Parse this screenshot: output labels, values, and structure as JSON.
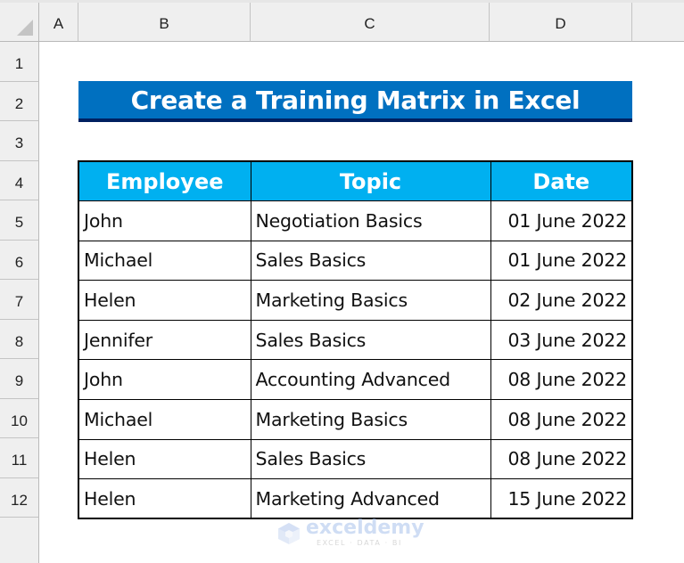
{
  "spreadsheet": {
    "column_headers": [
      "A",
      "B",
      "C",
      "D"
    ],
    "row_headers": [
      "1",
      "2",
      "3",
      "4",
      "5",
      "6",
      "7",
      "8",
      "9",
      "10",
      "11",
      "12"
    ]
  },
  "title": "Create a Training Matrix in Excel",
  "table": {
    "headers": [
      "Employee",
      "Topic",
      "Date"
    ],
    "rows": [
      {
        "employee": "John",
        "topic": "Negotiation Basics",
        "date": "01 June 2022"
      },
      {
        "employee": "Michael",
        "topic": "Sales Basics",
        "date": "01 June 2022"
      },
      {
        "employee": "Helen",
        "topic": "Marketing Basics",
        "date": "02 June 2022"
      },
      {
        "employee": "Jennifer",
        "topic": "Sales Basics",
        "date": "03 June 2022"
      },
      {
        "employee": "John",
        "topic": "Accounting Advanced",
        "date": "08 June 2022"
      },
      {
        "employee": "Michael",
        "topic": "Marketing Basics",
        "date": "08 June 2022"
      },
      {
        "employee": "Helen",
        "topic": "Sales Basics",
        "date": "08 June 2022"
      },
      {
        "employee": "Helen",
        "topic": "Marketing Advanced",
        "date": "15 June 2022"
      }
    ]
  },
  "watermark": {
    "name": "exceldemy",
    "tagline": "EXCEL · DATA · BI"
  },
  "colors": {
    "title_bg": "#0070c0",
    "title_border": "#002060",
    "header_bg": "#00b0f0"
  }
}
